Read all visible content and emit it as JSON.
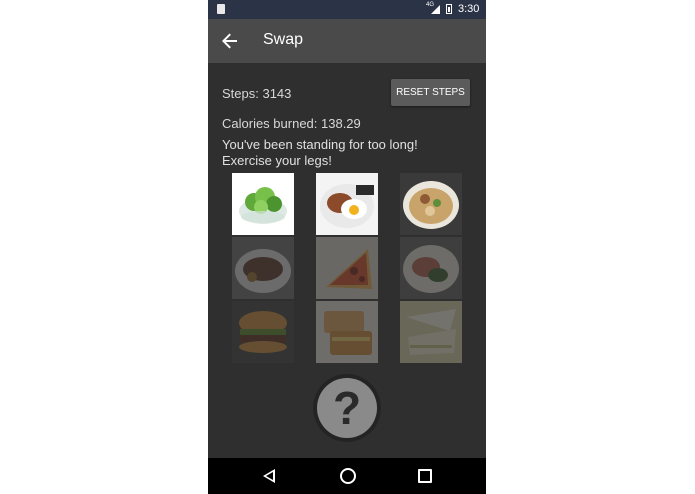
{
  "status_bar": {
    "network": "4G",
    "time": "3:30",
    "icons": [
      "sim-card-icon",
      "signal-icon",
      "battery-icon"
    ]
  },
  "app_bar": {
    "title": "Swap",
    "back_icon": "arrow-back-icon"
  },
  "steps": {
    "label": "Steps:  3143"
  },
  "reset_button": {
    "label": "RESET STEPS"
  },
  "calories": {
    "label": "Calories burned:  138.29"
  },
  "message": {
    "text": "You've been standing for too long! Exercise your legs!"
  },
  "food_grid": {
    "items": [
      {
        "name": "salad",
        "state": "active"
      },
      {
        "name": "egg-dish",
        "state": "active"
      },
      {
        "name": "noodle-soup",
        "state": "active"
      },
      {
        "name": "steak-plate",
        "state": "locked"
      },
      {
        "name": "pizza-slice",
        "state": "locked"
      },
      {
        "name": "meat-plate",
        "state": "locked"
      },
      {
        "name": "burger",
        "state": "locked"
      },
      {
        "name": "grilled-sandwich",
        "state": "locked"
      },
      {
        "name": "sandwich-wedges",
        "state": "locked"
      }
    ]
  },
  "help_button": {
    "symbol": "?",
    "icon": "question-mark-icon"
  },
  "nav_bar": {
    "icons": [
      "nav-back-icon",
      "nav-home-icon",
      "nav-recents-icon"
    ]
  },
  "colors": {
    "status_bar": "#2b3447",
    "app_bar": "#4a4a4a",
    "background": "#2f2f2f",
    "button": "#5b5b5b",
    "nav_bar": "#000000"
  }
}
